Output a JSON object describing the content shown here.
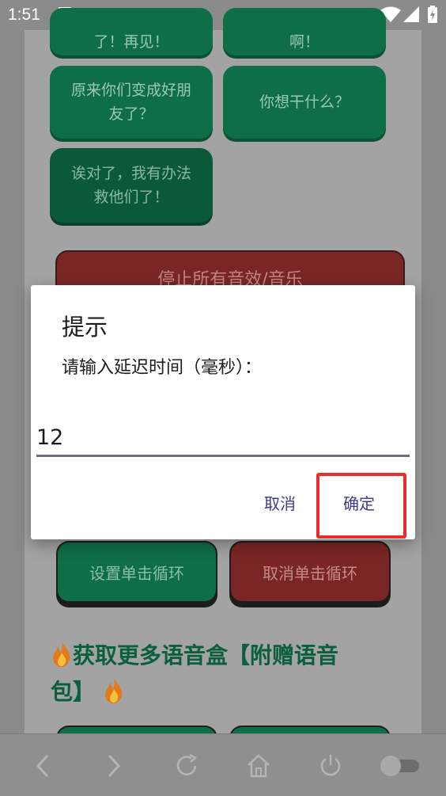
{
  "status_bar": {
    "time": "1:51"
  },
  "tiles": {
    "partial_left": "了！再见！",
    "partial_right": "啊！",
    "tile_1": "原来你们变成好朋\n友了？",
    "tile_2": "你想干什么？",
    "tile_3": "诶对了，我有办法\n救他们了！"
  },
  "stop_all_button": "停止所有音效/音乐",
  "set_loop_button": "设置单击循环",
  "cancel_loop_button": "取消单击循环",
  "more_heading_1": "获取更多语音盒【附赠语音",
  "more_heading_2": "包】",
  "dialog": {
    "title": "提示",
    "message": "请输入延迟时间（毫秒）：",
    "input_value": "12",
    "cancel_label": "取消",
    "ok_label": "确定"
  },
  "colors": {
    "accent": "#0e6e47",
    "highlight": "#ee2a2a",
    "dialog_button": "#3f3a8a"
  }
}
